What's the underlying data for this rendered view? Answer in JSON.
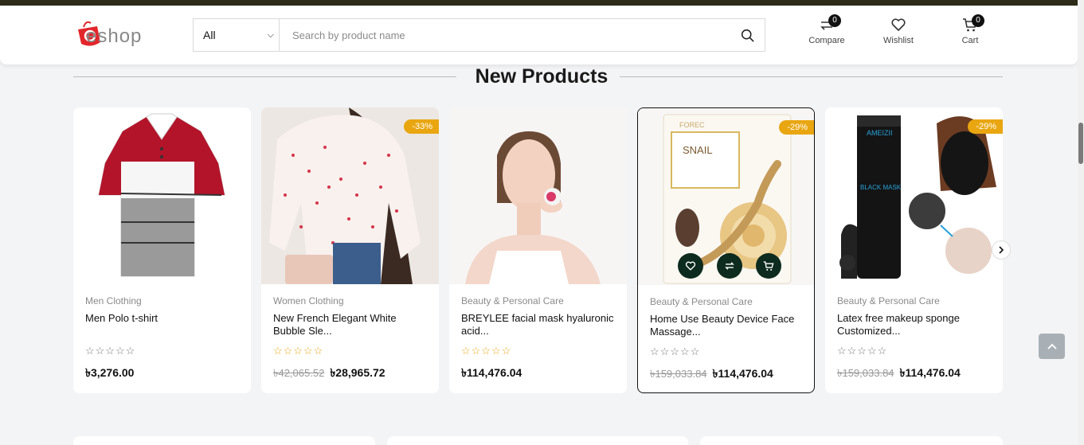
{
  "header": {
    "logo_text": "eshop",
    "category_select": "All",
    "search_placeholder": "Search by product name",
    "compare": {
      "label": "Compare",
      "count": "0"
    },
    "wishlist": {
      "label": "Wishlist"
    },
    "cart": {
      "label": "Cart",
      "count": "0"
    }
  },
  "section": {
    "title": "New Products"
  },
  "products": [
    {
      "category": "Men Clothing",
      "name": "Men Polo t-shirt",
      "old_price": "",
      "price": "৳3,276.00",
      "discount": "",
      "stars": "☆☆☆☆☆"
    },
    {
      "category": "Women Clothing",
      "name": "New French Elegant White Bubble Sle...",
      "old_price": "৳42,065.52",
      "price": "৳28,965.72",
      "discount": "-33%",
      "stars": "☆☆☆☆☆"
    },
    {
      "category": "Beauty & Personal Care",
      "name": "BREYLEE facial mask hyaluronic acid...",
      "old_price": "",
      "price": "৳114,476.04",
      "discount": "",
      "stars": "☆☆☆☆☆"
    },
    {
      "category": "Beauty & Personal Care",
      "name": "Home Use Beauty Device Face Massage...",
      "old_price": "৳159,033.84",
      "price": "৳114,476.04",
      "discount": "-29%",
      "stars": "☆☆☆☆☆"
    },
    {
      "category": "Beauty & Personal Care",
      "name": "Latex free makeup sponge Customized...",
      "old_price": "৳159,033.84",
      "price": "৳114,476.04",
      "discount": "-29%",
      "stars": "☆☆☆☆☆"
    }
  ],
  "product_images": {
    "snail_mask_brand": "FOREC",
    "snail_mask_title": "SNAIL",
    "black_mask_brand": "AMEIZII",
    "black_mask_title": "BLACK MASK"
  },
  "icons": {
    "search": "search-icon",
    "compare": "compare-icon",
    "wishlist": "heart-icon",
    "cart": "cart-icon",
    "next": "chevron-right-icon",
    "back_to_top": "chevron-up-icon"
  },
  "colors": {
    "accent": "#e9a611",
    "action_button": "#0d2b1f",
    "logo_red": "#e2262b"
  }
}
